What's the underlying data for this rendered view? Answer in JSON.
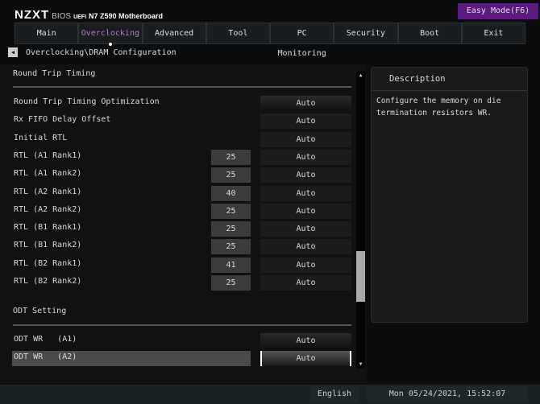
{
  "header": {
    "brand": "NZXT",
    "bios": "BIOS",
    "uefi": "UEFI",
    "model": "N7 Z590 Motherboard",
    "easy_mode": "Easy Mode(F6)"
  },
  "tabs": [
    {
      "label": "Main"
    },
    {
      "label": "Overclocking",
      "active": true
    },
    {
      "label": "Advanced"
    },
    {
      "label": "Tool"
    },
    {
      "label": "PC Monitoring"
    },
    {
      "label": "Security"
    },
    {
      "label": "Boot"
    },
    {
      "label": "Exit"
    }
  ],
  "breadcrumb": "Overclocking\\DRAM Configuration",
  "sections": {
    "round_trip": "Round Trip Timing",
    "odt": "ODT Setting"
  },
  "rows": [
    {
      "label": "Round Trip Timing Optimization",
      "setting": "Auto"
    },
    {
      "label": "Rx FIFO Delay Offset",
      "setting": "Auto"
    },
    {
      "label": "Initial RTL",
      "setting": "Auto"
    },
    {
      "label": "RTL (A1 Rank1)",
      "value": "25",
      "setting": "Auto"
    },
    {
      "label": "RTL (A1 Rank2)",
      "value": "25",
      "setting": "Auto"
    },
    {
      "label": "RTL (A2 Rank1)",
      "value": "40",
      "setting": "Auto"
    },
    {
      "label": "RTL (A2 Rank2)",
      "value": "25",
      "setting": "Auto"
    },
    {
      "label": "RTL (B1 Rank1)",
      "value": "25",
      "setting": "Auto"
    },
    {
      "label": "RTL (B1 Rank2)",
      "value": "25",
      "setting": "Auto"
    },
    {
      "label": "RTL (B2 Rank1)",
      "value": "41",
      "setting": "Auto"
    },
    {
      "label": "RTL (B2 Rank2)",
      "value": "25",
      "setting": "Auto"
    }
  ],
  "odt_rows": [
    {
      "label": "ODT WR   (A1)",
      "setting": "Auto"
    },
    {
      "label": "ODT WR   (A2)",
      "setting": "Auto",
      "selected": true
    }
  ],
  "description": {
    "title": "Description",
    "text": "Configure the memory on die termination resistors WR."
  },
  "footer": {
    "language": "English",
    "datetime": "Mon 05/24/2021, 15:52:07"
  },
  "colors": {
    "accent": "#c070d0",
    "easy_mode_bg": "#5a1a80"
  }
}
